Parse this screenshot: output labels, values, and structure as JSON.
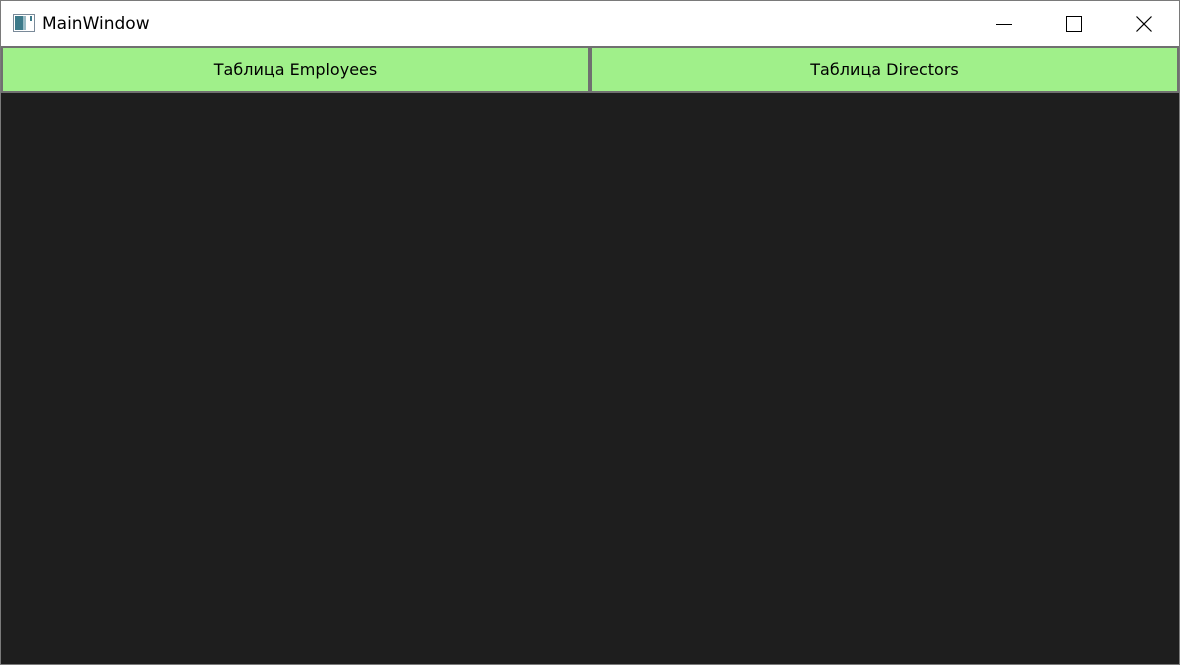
{
  "window": {
    "title": "MainWindow",
    "app_icon": "app-window-icon"
  },
  "caption_buttons": {
    "minimize": "minimize-icon",
    "maximize": "maximize-icon",
    "close": "close-icon"
  },
  "buttons": [
    {
      "label": "Таблица Employees"
    },
    {
      "label": "Таблица Directors"
    }
  ],
  "colors": {
    "button_background": "#a0f08a",
    "button_border": "#707070",
    "content_background": "#1e1e1e",
    "titlebar_background": "#ffffff"
  }
}
